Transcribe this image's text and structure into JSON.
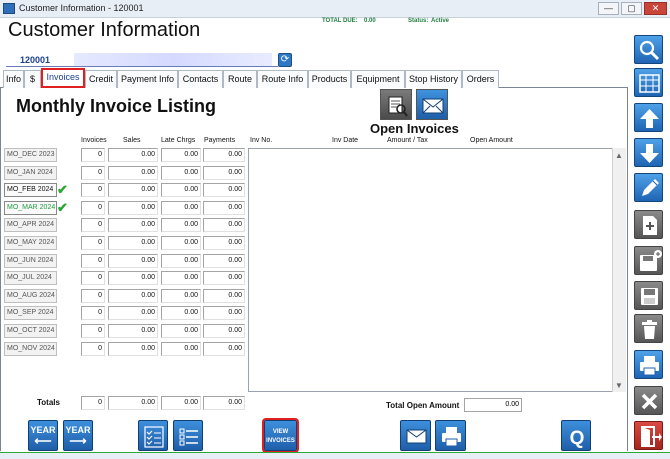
{
  "window": {
    "title": "Customer Information - 120001",
    "controls": {
      "minimize": "—",
      "maximize": "▢",
      "close": "✕"
    }
  },
  "header": {
    "title": "Customer Information",
    "total_due_label": "TOTAL DUE:",
    "total_due_value": "0.00",
    "status_label": "Status:",
    "status_value": "Active",
    "customer_id": "120001",
    "refresh_icon": "refresh-icon"
  },
  "tabs": [
    {
      "label": "Info",
      "active": false
    },
    {
      "label": "$",
      "active": false
    },
    {
      "label": "Invoices",
      "active": true
    },
    {
      "label": "Credit",
      "active": false
    },
    {
      "label": "Payment Info",
      "active": false
    },
    {
      "label": "Contacts",
      "active": false
    },
    {
      "label": "Route",
      "active": false
    },
    {
      "label": "Route Info",
      "active": false
    },
    {
      "label": "Products",
      "active": false
    },
    {
      "label": "Equipment",
      "active": false
    },
    {
      "label": "Stop History",
      "active": false
    },
    {
      "label": "Orders",
      "active": false
    }
  ],
  "listing": {
    "title": "Monthly Invoice Listing",
    "columns": [
      "Invoices",
      "Sales",
      "Late Chrgs",
      "Payments"
    ],
    "months": [
      {
        "label": "MO_DEC 2023",
        "invoices": "0",
        "sales": "0.00",
        "late": "0.00",
        "payments": "0.00",
        "marked": false,
        "style": "normal"
      },
      {
        "label": "MO_JAN 2024",
        "invoices": "0",
        "sales": "0.00",
        "late": "0.00",
        "payments": "0.00",
        "marked": false,
        "style": "normal"
      },
      {
        "label": "MO_FEB 2024",
        "invoices": "0",
        "sales": "0.00",
        "late": "0.00",
        "payments": "0.00",
        "marked": true,
        "style": "current"
      },
      {
        "label": "MO_MAR 2024",
        "invoices": "0",
        "sales": "0.00",
        "late": "0.00",
        "payments": "0.00",
        "marked": true,
        "style": "next"
      },
      {
        "label": "MO_APR 2024",
        "invoices": "0",
        "sales": "0.00",
        "late": "0.00",
        "payments": "0.00",
        "marked": false,
        "style": "normal"
      },
      {
        "label": "MO_MAY 2024",
        "invoices": "0",
        "sales": "0.00",
        "late": "0.00",
        "payments": "0.00",
        "marked": false,
        "style": "normal"
      },
      {
        "label": "MO_JUN 2024",
        "invoices": "0",
        "sales": "0.00",
        "late": "0.00",
        "payments": "0.00",
        "marked": false,
        "style": "normal"
      },
      {
        "label": "MO_JUL 2024",
        "invoices": "0",
        "sales": "0.00",
        "late": "0.00",
        "payments": "0.00",
        "marked": false,
        "style": "normal"
      },
      {
        "label": "MO_AUG 2024",
        "invoices": "0",
        "sales": "0.00",
        "late": "0.00",
        "payments": "0.00",
        "marked": false,
        "style": "normal"
      },
      {
        "label": "MO_SEP 2024",
        "invoices": "0",
        "sales": "0.00",
        "late": "0.00",
        "payments": "0.00",
        "marked": false,
        "style": "normal"
      },
      {
        "label": "MO_OCT 2024",
        "invoices": "0",
        "sales": "0.00",
        "late": "0.00",
        "payments": "0.00",
        "marked": false,
        "style": "normal"
      },
      {
        "label": "MO_NOV 2024",
        "invoices": "0",
        "sales": "0.00",
        "late": "0.00",
        "payments": "0.00",
        "marked": false,
        "style": "normal"
      }
    ],
    "totals_label": "Totals",
    "totals": {
      "invoices": "0",
      "sales": "0.00",
      "late": "0.00",
      "payments": "0.00"
    }
  },
  "open_invoices": {
    "title": "Open Invoices",
    "columns": [
      "Inv No.",
      "Inv Date",
      "Amount / Tax",
      "Open Amount"
    ],
    "total_open_label": "Total Open Amount",
    "total_open_value": "0.00"
  },
  "bottom_buttons": {
    "year_back_label": "YEAR",
    "year_forward_label": "YEAR",
    "view_invoices_line1": "VIEW",
    "view_invoices_line2": "INVOICES"
  },
  "colors": {
    "accent_blue": "#2a74c4",
    "highlight_red": "#e02020",
    "status_green": "#1e7f3e",
    "check_green": "#2aa836"
  },
  "sidebar_icons": [
    "search-icon",
    "grid-view-icon",
    "arrow-up-icon",
    "arrow-down-icon",
    "edit-pencil-icon",
    "new-document-icon",
    "save-new-icon",
    "save-icon",
    "delete-trash-icon",
    "print-icon",
    "close-x-icon",
    "exit-door-icon"
  ]
}
